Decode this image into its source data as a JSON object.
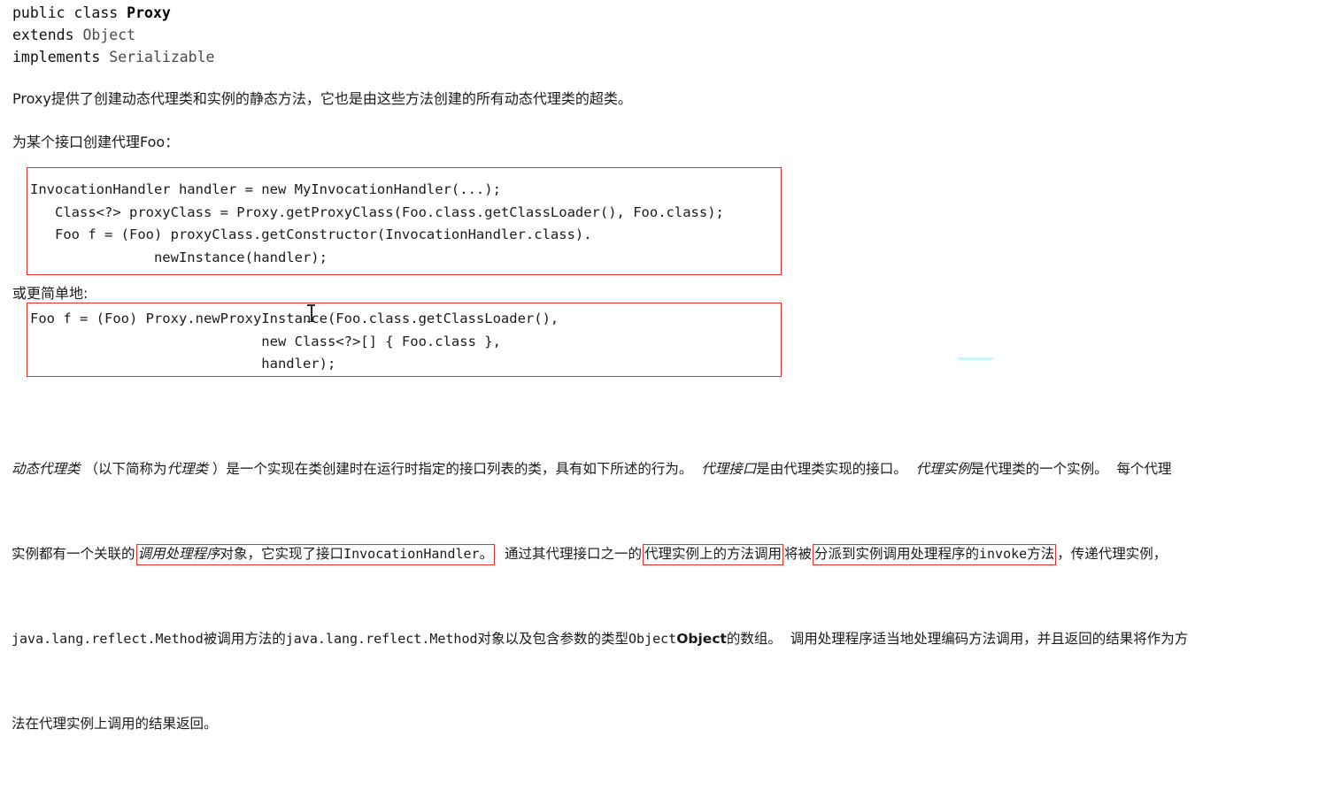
{
  "document": {
    "signature": {
      "line1_prefix": "public class ",
      "line1_class": "Proxy",
      "line2_keyword": "extends ",
      "line2_type": "Object",
      "line3_keyword": "implements ",
      "line3_type": "Serializable"
    },
    "intro": {
      "paragraph1": "Proxy提供了创建动态代理类和实例的静态方法，它也是由这些方法创建的所有动态代理类的超类。",
      "paragraph2": "为某个接口创建代理Foo："
    },
    "code_block_1": {
      "lines": [
        "InvocationHandler handler = new MyInvocationHandler(...);",
        "   Class<?> proxyClass = Proxy.getProxyClass(Foo.class.getClassLoader(), Foo.class);",
        "   Foo f = (Foo) proxyClass.getConstructor(InvocationHandler.class).",
        "               newInstance(handler);"
      ]
    },
    "label_simpler": "或更简单地:",
    "code_block_2": {
      "lines": [
        "Foo f = (Foo) Proxy.newProxyInstance(Foo.class.getClassLoader(),",
        "                            new Class<?>[] { Foo.class },",
        "                            handler);"
      ]
    },
    "description": {
      "line1": {
        "seg1_italic": "动态代理类",
        "seg2": " （以下简称为",
        "seg3_italic": "代理类",
        "seg4": " ）是一个实现在类创建时在运行时指定的接口列表的类，具有如下所述的行为。  ",
        "seg5_italic": "代理接口",
        "seg6": "是由代理类实现的接口。  ",
        "seg7_italic": "代理实例",
        "seg8": "是代理类的一个实例。  每个代理"
      },
      "line2": {
        "seg1": "实例都有一个关联的",
        "highlight1_italic": "调用处理程序",
        "highlight1_rest": "对象，它实现了接口",
        "highlight1_mono": "InvocationHandler",
        "highlight1_tail": "。",
        "seg2": "  通过其代理接口之一的",
        "highlight2": "代理实例上的方法调用",
        "seg3": "将被",
        "highlight3_a": "分派到实例调用处理程序的",
        "highlight3_mono": "invoke",
        "highlight3_b": "方法",
        "seg4": "，传递代理实例，"
      },
      "line3": {
        "seg1_mono": "java.lang.reflect.Method",
        "seg2": "被调用方法的",
        "seg3_mono": "java.lang.reflect.Method",
        "seg4": "对象以及包含参数的类型",
        "seg5_mono": "Object",
        "seg6_bold": "Object",
        "seg7": "的数组。  调用处理程序适当地处理编码方法调用，并且返回的结果将作为方"
      },
      "line4": {
        "seg1": "法在代理实例上调用的结果返回。"
      }
    },
    "colors": {
      "highlight_border": "#e8302a",
      "text": "#1a1a1a",
      "background": "#ffffff",
      "cyan_artifact": "#c8f4fb"
    }
  }
}
